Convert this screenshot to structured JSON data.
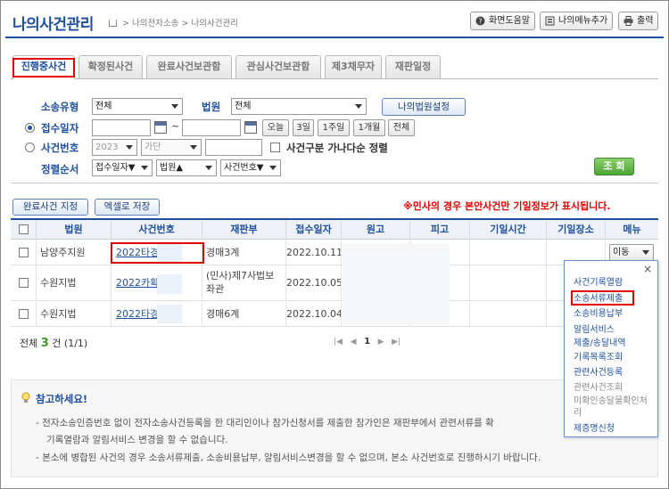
{
  "header": {
    "title": "나의사건관리",
    "breadcrumb": [
      "나의전자소송",
      "나의사건관리"
    ],
    "buttons": [
      {
        "label": "화면도움말",
        "icon": "help-icon"
      },
      {
        "label": "나의메뉴추가",
        "icon": "bookmark-icon"
      },
      {
        "label": "출력",
        "icon": "printer-icon"
      }
    ]
  },
  "tabs": [
    "진행중사건",
    "확정된사건",
    "완료사건보관함",
    "관심사건보관함",
    "제3채무자",
    "재판일정"
  ],
  "search": {
    "litigation_type_label": "소송유형",
    "litigation_type_value": "전체",
    "court_label": "법원",
    "court_value": "전체",
    "my_court_button": "나의법원설정",
    "receipt_date_label": "접수일자",
    "date_separator": "~",
    "quick_buttons": [
      "오늘",
      "3일",
      "1주일",
      "1개월",
      "전체"
    ],
    "case_number_label": "사건번호",
    "year_value": "2023",
    "case_type_value": "가단",
    "case_sort_checkbox_label": "사건구분 가나다순 정렬",
    "sort_order_label": "정렬순서",
    "sort_values": [
      "접수일자▼",
      "법원▲",
      "사건번호▼"
    ],
    "search_button": "조 회"
  },
  "toolbar": {
    "complete_button": "완료사건 지정",
    "excel_button": "엑셀로 저장",
    "notice": "※민사의 경우 본안사건만 기일정보가 표시됩니다."
  },
  "table": {
    "headers": [
      "법원",
      "사건번호",
      "재판부",
      "접수일자",
      "원고",
      "피고",
      "기일시간",
      "기일장소",
      "메뉴"
    ],
    "rows": [
      {
        "court": "남양주지원",
        "case_no": "2022타경",
        "division": "경매3계",
        "date": "2022.10.11"
      },
      {
        "court": "수원지법",
        "case_no": "2022카확",
        "division": "(민사)제7사법보좌관",
        "date": "2022.10.05"
      },
      {
        "court": "수원지법",
        "case_no": "2022타경",
        "division": "경매6계",
        "date": "2022.10.04"
      }
    ],
    "menu_button": "이동"
  },
  "footer": {
    "total_prefix": "전체",
    "total_count": "3",
    "total_suffix": "건 (1/1)",
    "current_page": "1"
  },
  "move_menu": {
    "close": "×",
    "items": [
      "사건기록열람",
      "소송서류제출",
      "소송비용납부",
      "알림서비스",
      "제출/송달내역",
      "기록목록조회",
      "관련사건등록",
      "관련사건조회",
      "미확인송달물확인처리",
      "제증명신청"
    ]
  },
  "notes": {
    "title": "참고하세요!",
    "lines": [
      "- 전자소송인증번호 없이 전자소송사건등록을 한 대리인이나 참가신청서를 제출한 참가인은 재판부에서 관련서류를 확",
      "기록열람과 알림서비스 변경을 할 수 없습니다.",
      "- 본소에 병합된 사건의 경우 소송서류제출, 소송비용납부, 알림서비스변경을 할 수 없으며, 본소 사건번호로 진행하시기 바랍니다."
    ]
  }
}
